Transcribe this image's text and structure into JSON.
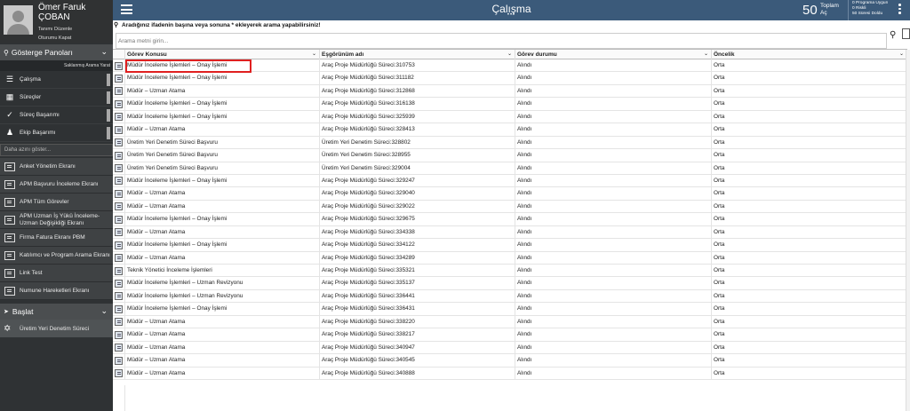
{
  "user": {
    "name": "Ömer Faruk ÇOBAN",
    "profile_link": "Tanımı Düzenle",
    "logout_link": "Oturumu Kapat"
  },
  "sidebar": {
    "dashboards_title": "Gösterge Panoları",
    "saved_search": "Saklanmış Arama Yarat",
    "dash_items": [
      {
        "label": "Çalışma",
        "icon": "list-icon"
      },
      {
        "label": "Süreçler",
        "icon": "grid-icon"
      },
      {
        "label": "Süreç Başarımı",
        "icon": "check-chart-icon"
      },
      {
        "label": "Ekip Başarımı",
        "icon": "team-icon"
      }
    ],
    "more_placeholder": "Daha azını göster...",
    "proc_items": [
      {
        "label": "Anket Yönetim Ekranı"
      },
      {
        "label": "APM Başvuru İnceleme Ekranı"
      },
      {
        "label": "APM Tüm Görevler"
      },
      {
        "label": "APM Uzman İş Yükü İnceleme-Uzman Değişikliği Ekranı"
      },
      {
        "label": "Firma Fatura Ekranı PBM"
      },
      {
        "label": "Katılımcı ve Program Arama Ekranı"
      },
      {
        "label": "Link Test"
      },
      {
        "label": "Numune Hareketleri Ekranı"
      }
    ],
    "start_title": "Başlat",
    "start_item": "Üretim Yeri Denetim Süreci"
  },
  "header": {
    "title": "Çalışma",
    "count": "50",
    "count_label_1": "Toplam",
    "count_label_2": "Aç",
    "stats": [
      "0 Programa Uygun",
      "0 Riskli",
      "50 Süresi Doldu"
    ]
  },
  "search": {
    "hint": "Aradığınız ifadenin başına veya sonuna * ekleyerek arama yapabilirsiniz!",
    "placeholder": "Arama metni girin..."
  },
  "table": {
    "columns": [
      "Görev Konusu",
      "Eşgörünüm adı",
      "Görev durumu",
      "Öncelik"
    ],
    "rows": [
      [
        "Müdür İnceleme İşlemleri – Onay İşlemi",
        "Araç Proje Müdürlüğü Süreci:310753",
        "Alındı",
        "Orta"
      ],
      [
        "Müdür İnceleme İşlemleri – Onay İşlemi",
        "Araç Proje Müdürlüğü Süreci:311182",
        "Alındı",
        "Orta"
      ],
      [
        "Müdür – Uzman Atama",
        "Araç Proje Müdürlüğü Süreci:312868",
        "Alındı",
        "Orta"
      ],
      [
        "Müdür İnceleme İşlemleri – Onay İşlemi",
        "Araç Proje Müdürlüğü Süreci:316138",
        "Alındı",
        "Orta"
      ],
      [
        "Müdür İnceleme İşlemleri – Onay İşlemi",
        "Araç Proje Müdürlüğü Süreci:325939",
        "Alındı",
        "Orta"
      ],
      [
        "Müdür – Uzman Atama",
        "Araç Proje Müdürlüğü Süreci:328413",
        "Alındı",
        "Orta"
      ],
      [
        "Üretim Yeri Denetim Süreci Başvuru",
        "Üretim Yeri Denetim Süreci:328802",
        "Alındı",
        "Orta"
      ],
      [
        "Üretim Yeri Denetim Süreci Başvuru",
        "Üretim Yeri Denetim Süreci:328955",
        "Alındı",
        "Orta"
      ],
      [
        "Üretim Yeri Denetim Süreci Başvuru",
        "Üretim Yeri Denetim Süreci:329004",
        "Alındı",
        "Orta"
      ],
      [
        "Müdür İnceleme İşlemleri – Onay İşlemi",
        "Araç Proje Müdürlüğü Süreci:329247",
        "Alındı",
        "Orta"
      ],
      [
        "Müdür – Uzman Atama",
        "Araç Proje Müdürlüğü Süreci:329040",
        "Alındı",
        "Orta"
      ],
      [
        "Müdür – Uzman Atama",
        "Araç Proje Müdürlüğü Süreci:329022",
        "Alındı",
        "Orta"
      ],
      [
        "Müdür İnceleme İşlemleri – Onay İşlemi",
        "Araç Proje Müdürlüğü Süreci:329675",
        "Alındı",
        "Orta"
      ],
      [
        "Müdür – Uzman Atama",
        "Araç Proje Müdürlüğü Süreci:334338",
        "Alındı",
        "Orta"
      ],
      [
        "Müdür İnceleme İşlemleri – Onay İşlemi",
        "Araç Proje Müdürlüğü Süreci:334122",
        "Alındı",
        "Orta"
      ],
      [
        "Müdür – Uzman Atama",
        "Araç Proje Müdürlüğü Süreci:334289",
        "Alındı",
        "Orta"
      ],
      [
        "Teknik Yönetici İnceleme İşlemleri",
        "Araç Proje Müdürlüğü Süreci:335321",
        "Alındı",
        "Orta"
      ],
      [
        "Müdür İnceleme İşlemleri – Uzman Revizyonu",
        "Araç Proje Müdürlüğü Süreci:335137",
        "Alındı",
        "Orta"
      ],
      [
        "Müdür İnceleme İşlemleri – Uzman Revizyonu",
        "Araç Proje Müdürlüğü Süreci:336441",
        "Alındı",
        "Orta"
      ],
      [
        "Müdür İnceleme İşlemleri – Onay İşlemi",
        "Araç Proje Müdürlüğü Süreci:336431",
        "Alındı",
        "Orta"
      ],
      [
        "Müdür – Uzman Atama",
        "Araç Proje Müdürlüğü Süreci:338220",
        "Alındı",
        "Orta"
      ],
      [
        "Müdür – Uzman Atama",
        "Araç Proje Müdürlüğü Süreci:338217",
        "Alındı",
        "Orta"
      ],
      [
        "Müdür – Uzman Atama",
        "Araç Proje Müdürlüğü Süreci:340947",
        "Alındı",
        "Orta"
      ],
      [
        "Müdür – Uzman Atama",
        "Araç Proje Müdürlüğü Süreci:340545",
        "Alındı",
        "Orta"
      ],
      [
        "Müdür – Uzman Atama",
        "Araç Proje Müdürlüğü Süreci:340888",
        "Alındı",
        "Orta"
      ]
    ]
  },
  "colors": {
    "topbar": "#3b5a7a",
    "sidebar": "#2f3234",
    "highlight": "#e02020"
  }
}
